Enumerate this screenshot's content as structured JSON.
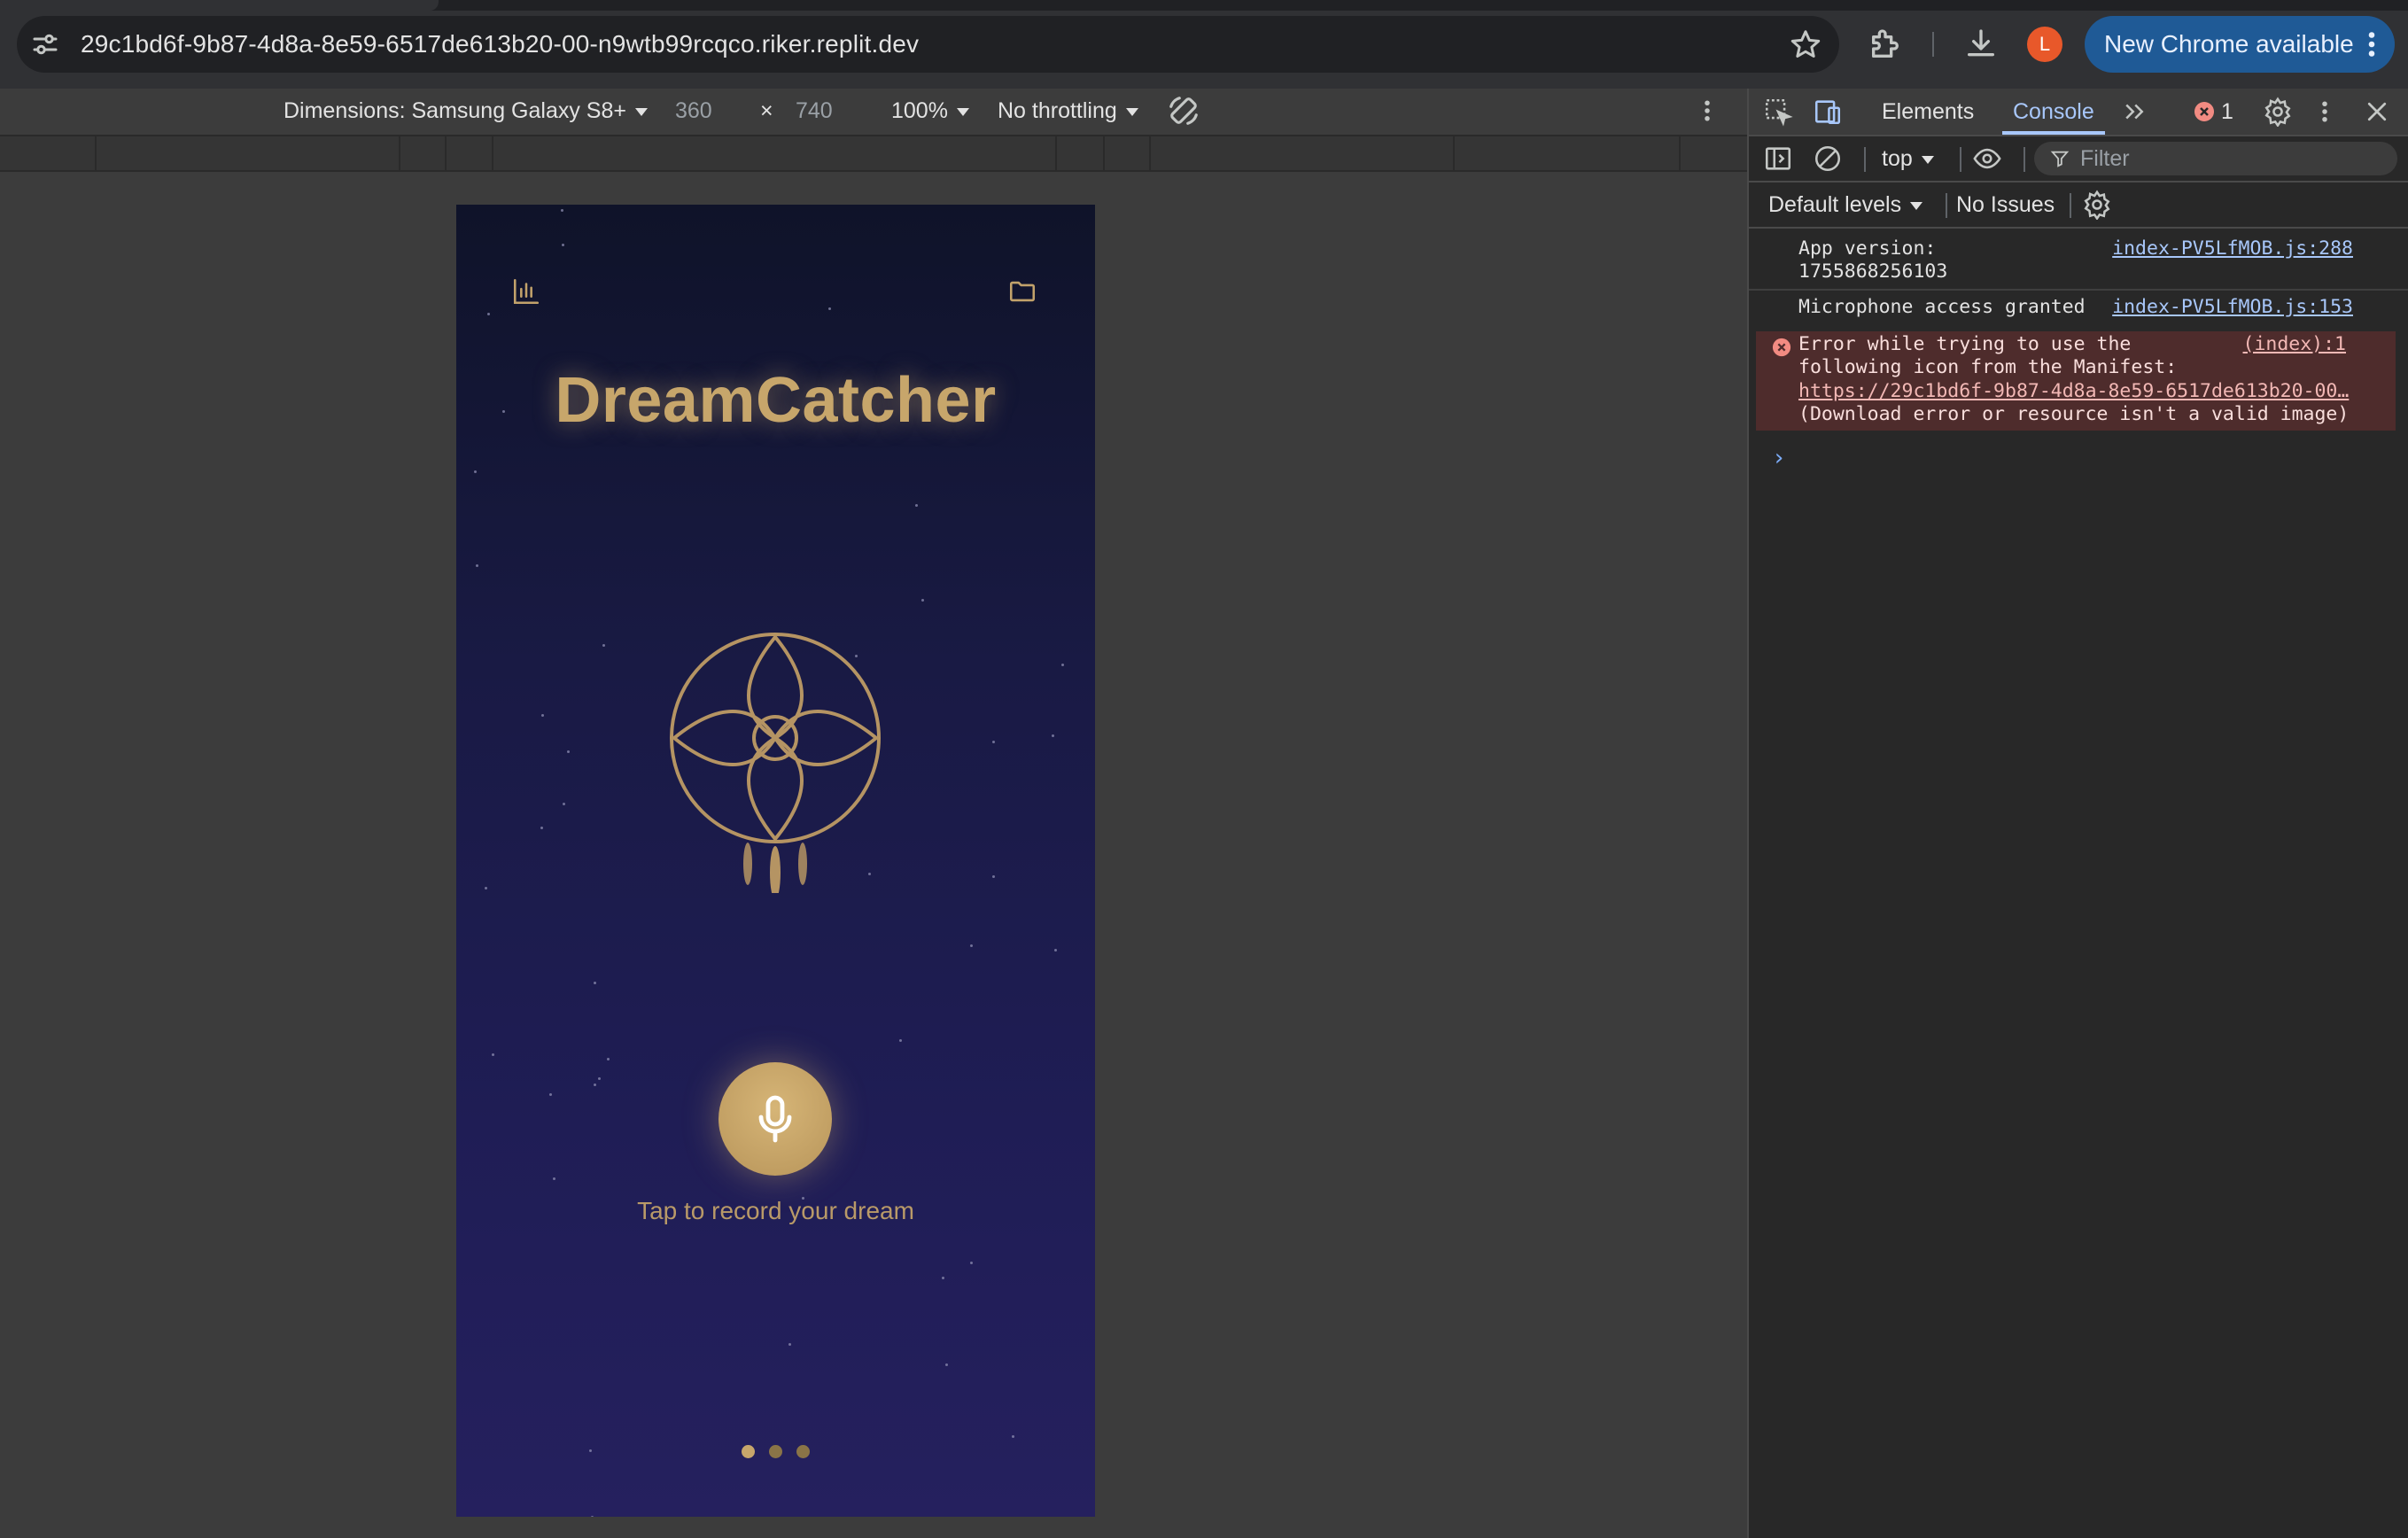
{
  "browser": {
    "url": "29c1bd6f-9b87-4d8a-8e59-6517de613b20-00-n9wtb99rcqco.riker.replit.dev",
    "avatar_letter": "L",
    "update_label": "New Chrome available"
  },
  "device_toolbar": {
    "dimensions_label": "Dimensions: Samsung Galaxy S8+",
    "width": "360",
    "times": "×",
    "height": "740",
    "zoom": "100%",
    "throttling": "No throttling"
  },
  "app": {
    "title": "DreamCatcher",
    "mic_caption": "Tap to record your dream",
    "pager_active_index": 0,
    "pager_count": 3,
    "accent_color": "#c7a66b"
  },
  "devtools": {
    "tabs": [
      "Elements",
      "Console"
    ],
    "active_tab": "Console",
    "error_count": "1",
    "context": "top",
    "filter_placeholder": "Filter",
    "levels": "Default levels",
    "issues": "No Issues",
    "messages": [
      {
        "type": "log",
        "text": "App version:\n1755868256103",
        "source": "index-PV5LfMOB.js:288"
      },
      {
        "type": "log",
        "text": "Microphone access granted",
        "source": "index-PV5LfMOB.js:153"
      },
      {
        "type": "error",
        "text": "Error while trying to use the\nfollowing icon from the Manifest:",
        "link": "https://29c1bd6f-9b87-4d8a-8e59-6517de613b20-00…",
        "text2": "(Download error or resource isn't a valid image)",
        "source": "(index):1"
      }
    ],
    "error_color": "#f28b82"
  }
}
